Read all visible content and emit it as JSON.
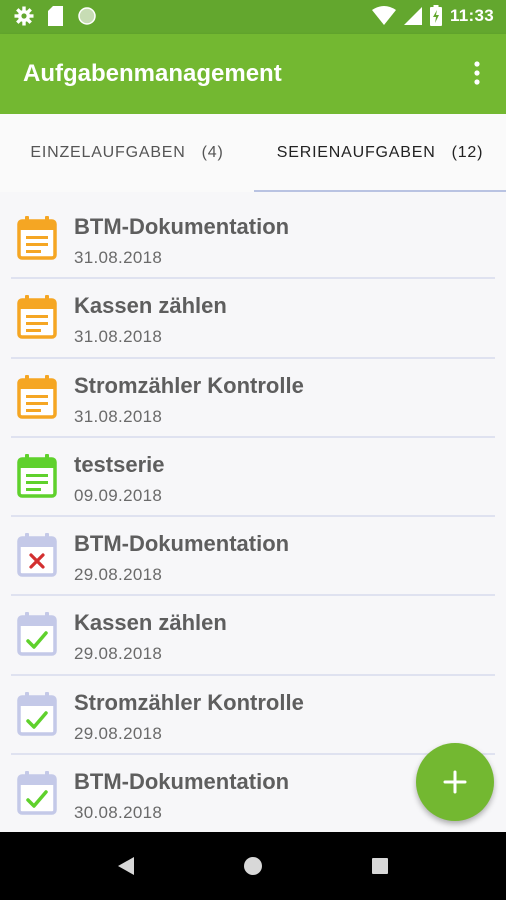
{
  "status_bar": {
    "time": "11:33",
    "icons": [
      "gear-icon",
      "sd-card-icon",
      "circle-icon",
      "wifi-icon",
      "signal-icon",
      "battery-charging-icon"
    ]
  },
  "app_bar": {
    "title": "Aufgabenmanagement",
    "menu_icon": "overflow-menu-icon"
  },
  "tabs": [
    {
      "label": "EINZELAUFGABEN",
      "count": "(4)",
      "selected": false
    },
    {
      "label": "SERIENAUFGABEN",
      "count": "(12)",
      "selected": true
    }
  ],
  "tasks": [
    {
      "title": "BTM-Dokumentation",
      "date": "31.08.2018",
      "status": "open",
      "icon": "calendar-notes-icon"
    },
    {
      "title": "Kassen zählen",
      "date": "31.08.2018",
      "status": "open",
      "icon": "calendar-notes-icon"
    },
    {
      "title": "Stromzähler Kontrolle",
      "date": "31.08.2018",
      "status": "open",
      "icon": "calendar-notes-icon"
    },
    {
      "title": "testserie",
      "date": "09.09.2018",
      "status": "current",
      "icon": "calendar-notes-icon"
    },
    {
      "title": "BTM-Dokumentation",
      "date": "29.08.2018",
      "status": "missed",
      "icon": "calendar-x-icon"
    },
    {
      "title": "Kassen zählen",
      "date": "29.08.2018",
      "status": "done",
      "icon": "calendar-check-icon"
    },
    {
      "title": "Stromzähler Kontrolle",
      "date": "29.08.2018",
      "status": "done",
      "icon": "calendar-check-icon"
    },
    {
      "title": "BTM-Dokumentation",
      "date": "30.08.2018",
      "status": "done",
      "icon": "calendar-check-icon"
    }
  ],
  "fab": {
    "icon": "plus-icon"
  },
  "nav": {
    "icons": [
      "back-icon",
      "home-icon",
      "recents-icon"
    ]
  },
  "colors": {
    "status_bar": "#63a72e",
    "app_bar": "#73b831",
    "open": "#f5a623",
    "current": "#5fd12c",
    "missed_x": "#d32f2f",
    "done_check": "#5fd12c",
    "inactive_calendar": "#c4c9e8"
  }
}
